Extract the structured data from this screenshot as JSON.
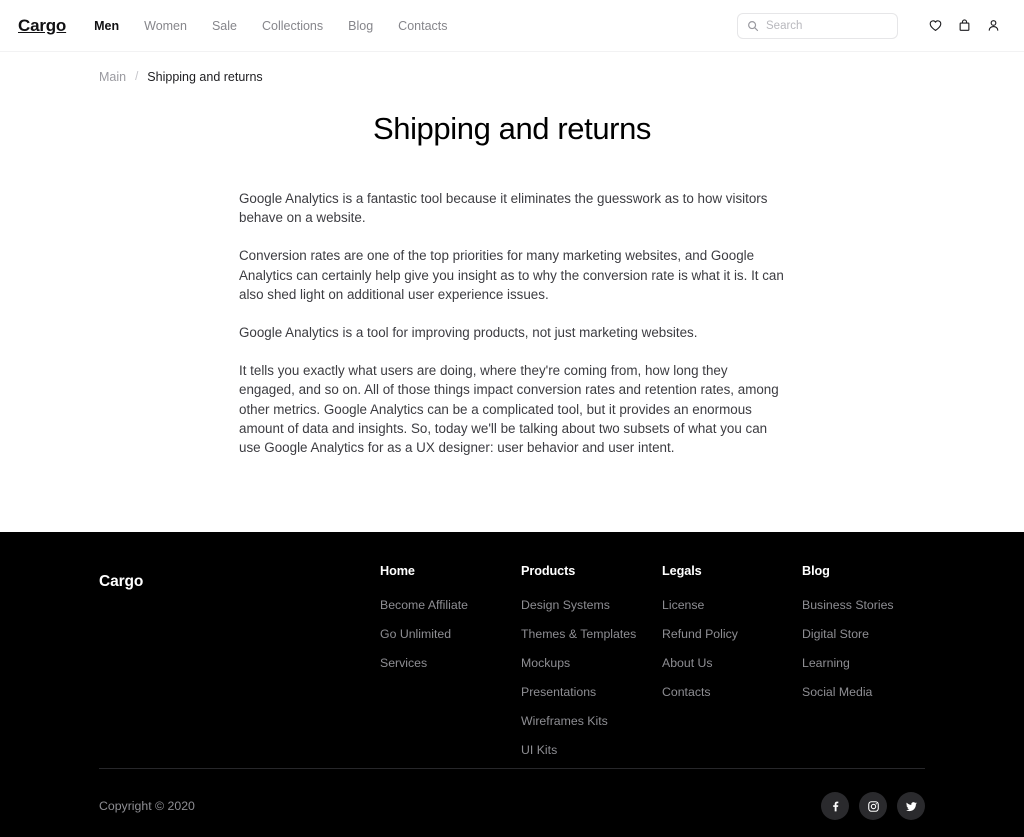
{
  "header": {
    "logo": "Cargo",
    "nav": [
      {
        "label": "Men",
        "active": true
      },
      {
        "label": "Women",
        "active": false
      },
      {
        "label": "Sale",
        "active": false
      },
      {
        "label": "Collections",
        "active": false
      },
      {
        "label": "Blog",
        "active": false
      },
      {
        "label": "Contacts",
        "active": false
      }
    ],
    "search": {
      "placeholder": "Search",
      "value": ""
    },
    "icons": [
      "heart-icon",
      "shopping-bag-icon",
      "user-icon"
    ]
  },
  "breadcrumb": {
    "root": "Main",
    "separator": "/",
    "current": "Shipping and returns"
  },
  "main": {
    "title": "Shipping and returns",
    "paragraphs": [
      "Google Analytics is a fantastic tool because it eliminates the guesswork as to how visitors behave on a website.",
      "Conversion rates are one of the top priorities for many marketing websites, and Google Analytics can certainly help give you insight as to why the conversion rate is what it is. It can also shed light on additional user experience issues.",
      "Google Analytics is a tool for improving products, not just marketing websites.",
      "It tells you exactly what users are doing, where they're coming from, how long they engaged, and so on. All of those things impact conversion rates and retention rates, among other metrics. Google Analytics can be a complicated tool, but it provides an enormous amount of data and insights. So, today we'll be talking about two subsets of what you can use Google Analytics for as a UX designer: user behavior and user intent."
    ]
  },
  "footer": {
    "brand": "Cargo",
    "columns": [
      {
        "title": "Home",
        "links": [
          "Become Affiliate",
          "Go Unlimited",
          "Services"
        ]
      },
      {
        "title": "Products",
        "links": [
          "Design Systems",
          "Themes & Templates",
          "Mockups",
          "Presentations",
          "Wireframes Kits",
          "UI Kits"
        ]
      },
      {
        "title": "Legals",
        "links": [
          "License",
          "Refund Policy",
          "About Us",
          "Contacts"
        ]
      },
      {
        "title": "Blog",
        "links": [
          "Business Stories",
          "Digital Store",
          "Learning",
          "Social Media"
        ]
      }
    ],
    "copyright": "Copyright © 2020",
    "socials": [
      "facebook-icon",
      "instagram-icon",
      "twitter-icon"
    ]
  },
  "colors": {
    "background": "#ffffff",
    "footer_background": "#000000",
    "text_primary": "#1d1d20",
    "text_muted": "#8e8e93",
    "body_text": "#3c3c41",
    "border": "#f2f2f3",
    "social_circle": "#2a2a2d"
  }
}
